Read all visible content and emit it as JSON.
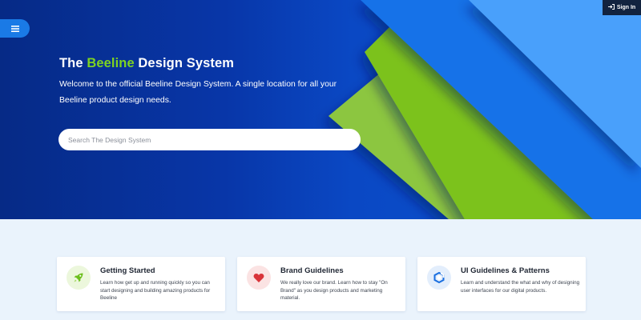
{
  "hero": {
    "title_prefix": "The ",
    "title_accent": "Beeline",
    "title_suffix": " Design System",
    "description": "Welcome to the official Beeline Design System. A single location for all your Beeline product design needs.",
    "search_placeholder": "Search The Design System"
  },
  "header": {
    "menu_icon": "hamburger-menu-icon",
    "signin_label": "Sign In",
    "signin_icon": "sign-in-icon"
  },
  "cards": [
    {
      "title": "Getting Started",
      "description": "Learn how get up and running quickly so you can start designing and building amazing products for Beeline",
      "icon": "rocket-icon"
    },
    {
      "title": "Brand Guidelines",
      "description": "We really love our brand. Learn how to stay \"On Brand\" as you design products and marketing material.",
      "icon": "heart-icon"
    },
    {
      "title": "UI Guidelines & Patterns",
      "description": "Learn and understand the what and why of designing user interfaces for our digital products.",
      "icon": "cube-icon"
    }
  ],
  "colors": {
    "hero_dark": "#062a86",
    "accent_green": "#7ed321",
    "light_blue": "#4da3ff",
    "card_bg": "#ffffff",
    "page_bg": "#eaf3fc"
  }
}
